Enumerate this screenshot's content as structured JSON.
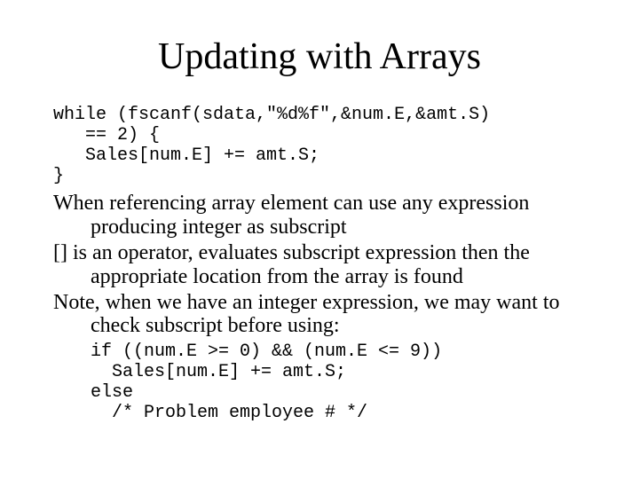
{
  "title": "Updating with Arrays",
  "code1_l1": "while (fscanf(sdata,\"%d%f\",&num.E,&amt.S)",
  "code1_l2": "   == 2) {",
  "code1_l3": "   Sales[num.E] += amt.S;",
  "code1_l4": "}",
  "para1": "When referencing array element can use any expression producing integer as subscript",
  "para2": "[] is an operator, evaluates subscript expression then the appropriate location from the array is found",
  "para3": "Note, when we have an integer expression, we may want to check subscript before using:",
  "code2_l1": "if ((num.E >= 0) && (num.E <= 9))",
  "code2_l2": "  Sales[num.E] += amt.S;",
  "code2_l3": "else",
  "code2_l4": "  /* Problem employee # */"
}
